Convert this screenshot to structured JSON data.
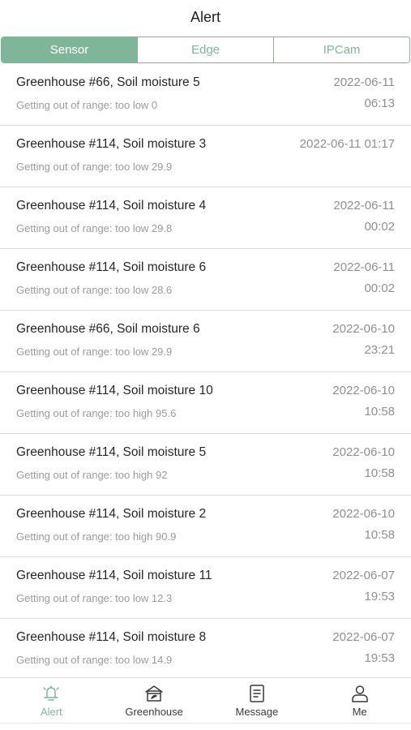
{
  "header": {
    "title": "Alert"
  },
  "segments": [
    {
      "label": "Sensor",
      "active": true
    },
    {
      "label": "Edge",
      "active": false
    },
    {
      "label": "IPCam",
      "active": false
    }
  ],
  "alerts": [
    {
      "title": "Greenhouse #66, Soil moisture 5",
      "detail": "Getting out of range: too low 0",
      "date": "2022-06-11",
      "time": "06:13"
    },
    {
      "title": "Greenhouse #114, Soil moisture 3",
      "detail": "Getting out of range: too low 29.9",
      "date": "2022-06-11 01:17",
      "time": ""
    },
    {
      "title": "Greenhouse #114, Soil moisture 4",
      "detail": "Getting out of range: too low 29.8",
      "date": "2022-06-11",
      "time": "00:02"
    },
    {
      "title": "Greenhouse #114, Soil moisture 6",
      "detail": "Getting out of range: too low 28.6",
      "date": "2022-06-11",
      "time": "00:02"
    },
    {
      "title": "Greenhouse #66, Soil moisture 6",
      "detail": "Getting out of range: too low 29.9",
      "date": "2022-06-10",
      "time": "23:21"
    },
    {
      "title": "Greenhouse #114, Soil moisture 10",
      "detail": "Getting out of range: too high 95.6",
      "date": "2022-06-10",
      "time": "10:58"
    },
    {
      "title": "Greenhouse #114, Soil moisture 5",
      "detail": "Getting out of range: too high 92",
      "date": "2022-06-10",
      "time": "10:58"
    },
    {
      "title": "Greenhouse #114, Soil moisture 2",
      "detail": "Getting out of range: too high 90.9",
      "date": "2022-06-10",
      "time": "10:58"
    },
    {
      "title": "Greenhouse #114, Soil moisture 11",
      "detail": "Getting out of range: too low 12.3",
      "date": "2022-06-07",
      "time": "19:53"
    },
    {
      "title": "Greenhouse #114, Soil moisture 8",
      "detail": "Getting out of range: too low 14.9",
      "date": "2022-06-07",
      "time": "19:53"
    }
  ],
  "tabbar": [
    {
      "label": "Alert",
      "icon": "bell-icon",
      "active": true
    },
    {
      "label": "Greenhouse",
      "icon": "greenhouse-icon",
      "active": false
    },
    {
      "label": "Message",
      "icon": "message-icon",
      "active": false
    },
    {
      "label": "Me",
      "icon": "person-icon",
      "active": false
    }
  ],
  "colors": {
    "accent": "#7fb699",
    "text": "#262626",
    "muted": "#9b9b9b"
  }
}
